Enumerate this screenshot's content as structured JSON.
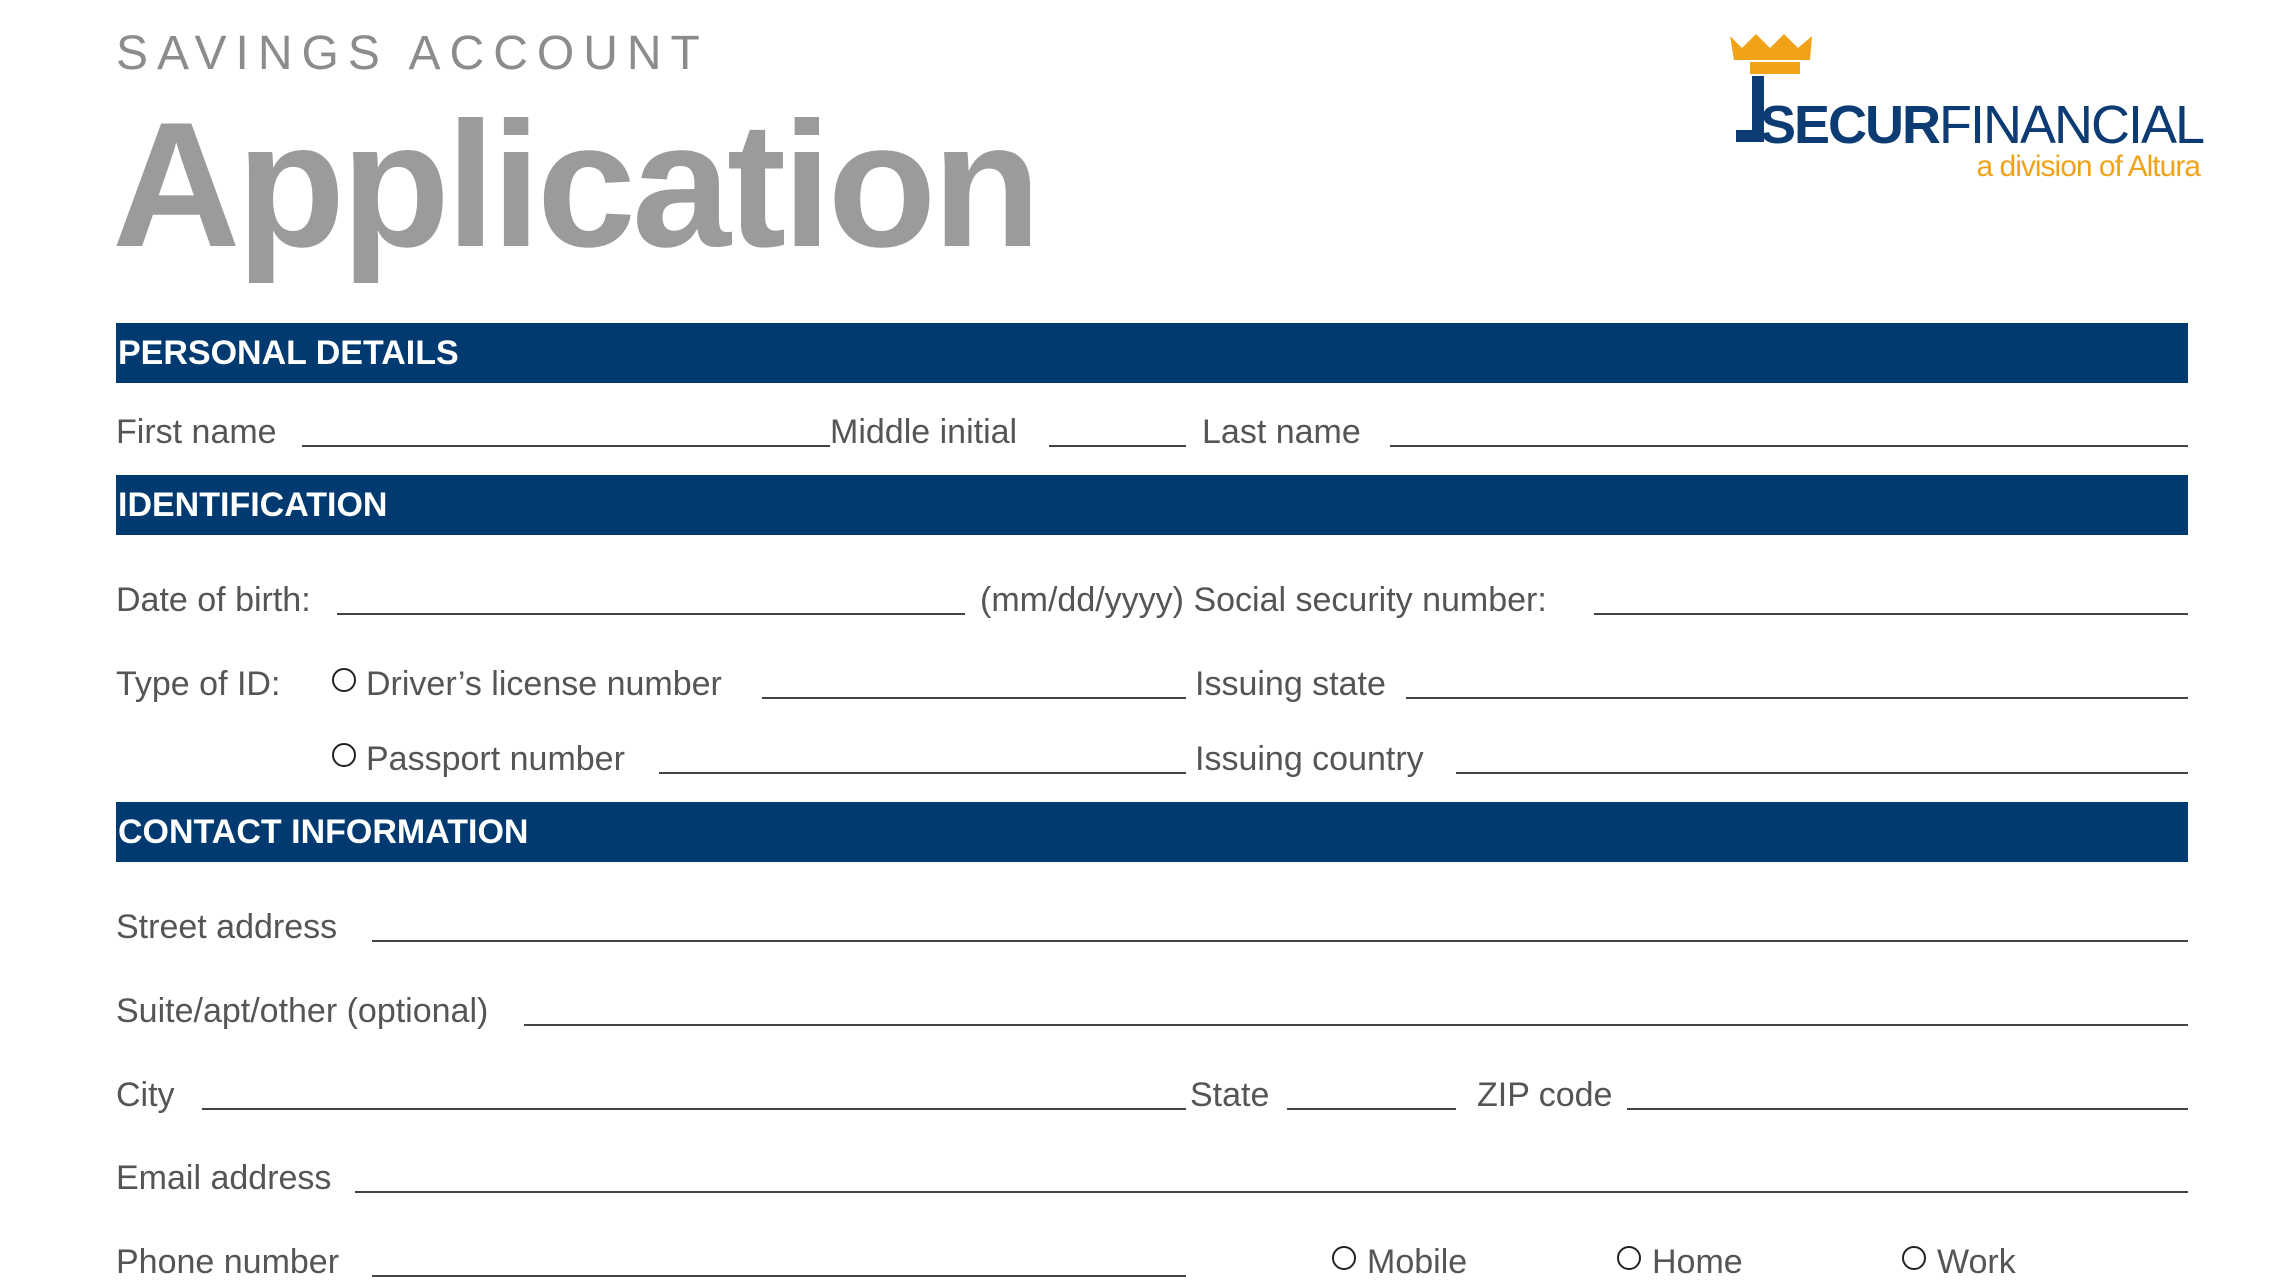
{
  "header": {
    "subtitle": "SAVINGS ACCOUNT",
    "title": "Application"
  },
  "logo": {
    "name_bold": "SECUR",
    "name_regular": "FINANCIAL",
    "tagline": "a division of Altura",
    "icon": "crown-icon",
    "colors": {
      "navy": "#0d3b73",
      "gold": "#f0a318"
    }
  },
  "sections": {
    "personal": "PERSONAL DETAILS",
    "identification": "IDENTIFICATION",
    "contact": "CONTACT INFORMATION"
  },
  "personal": {
    "first_name": "First name",
    "middle_initial": "Middle initial",
    "last_name": "Last name"
  },
  "identification": {
    "dob": "Date of birth:",
    "dob_format": "(mm/dd/yyyy) Social security number:",
    "type_of_id": "Type of ID:",
    "drivers_license": "Driver’s license number",
    "issuing_state": "Issuing state",
    "passport": "Passport number",
    "issuing_country": "Issuing country"
  },
  "contact": {
    "street": "Street address",
    "suite": "Suite/apt/other (optional)",
    "city": "City",
    "state": "State",
    "zip": "ZIP code",
    "email": "Email address",
    "phone": "Phone number",
    "phone_types": [
      "Mobile",
      "Home",
      "Work"
    ]
  },
  "colors": {
    "bar": "#003a70",
    "title": "#9b9b9b"
  }
}
